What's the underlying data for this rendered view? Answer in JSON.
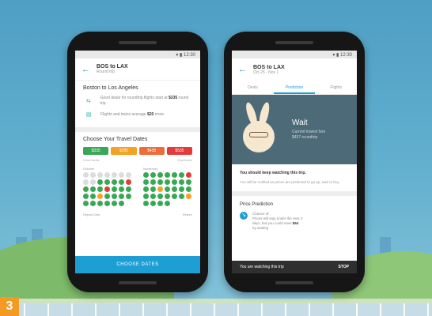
{
  "slide_number": "3",
  "left_phone": {
    "header": {
      "title": "BOS to LAX",
      "subtitle": "Round trip"
    },
    "route_card": {
      "title": "Boston to Los Angeles",
      "rows": [
        {
          "icon": "flight-icon",
          "text_before": "Good deals for roundtrip flights start at",
          "price": "$335",
          "text_after": "round trip"
        },
        {
          "icon": "bus-icon",
          "text_before": "Flights and trains average",
          "price": "$20",
          "text_after": "more"
        }
      ]
    },
    "dates": {
      "title": "Choose Your Travel Dates",
      "chips": [
        {
          "label": "$335",
          "color": "#3aa757"
        },
        {
          "label": "$385",
          "color": "#f4a224"
        },
        {
          "label": "$435",
          "color": "#ef6c39"
        },
        {
          "label": "$535",
          "color": "#e23b3b"
        }
      ],
      "legend_left": "Good deals",
      "legend_right": "Expensive",
      "months": [
        "October",
        "November"
      ],
      "footer": [
        "Depart Date",
        "Return"
      ]
    },
    "button_label": "CHOOSE DATES"
  },
  "right_phone": {
    "header": {
      "title": "BOS to LAX",
      "subtitle": "Oct 25 - Nov 1"
    },
    "tabs": [
      {
        "label": "Deals",
        "active": false
      },
      {
        "label": "Prediction",
        "active": true
      },
      {
        "label": "Flights",
        "active": false
      }
    ],
    "hero": {
      "title": "Wait",
      "line1": "Current lowest fare",
      "line2": "$437 roundtrip"
    },
    "advice": {
      "title": "You should keep watching this trip.",
      "text": "You will be notified as prices are predicted to go up, wait or buy."
    },
    "prediction": {
      "title": "Price Prediction",
      "line1": "Chance of",
      "line2": "Prices will stay under the next 4",
      "line3": "days, but you could save",
      "amount": "$54",
      "line4": "by waiting"
    },
    "watch_bar": {
      "text": "You are watching this trip",
      "action": "STOP"
    }
  },
  "colors": {
    "accent": "#1e9fd4",
    "hero_bg": "#4d6a79",
    "calendar_good": "#3aa757",
    "calendar_mid": "#f4a224",
    "calendar_bad": "#e23b3b",
    "calendar_empty": "#dcdcdc"
  }
}
